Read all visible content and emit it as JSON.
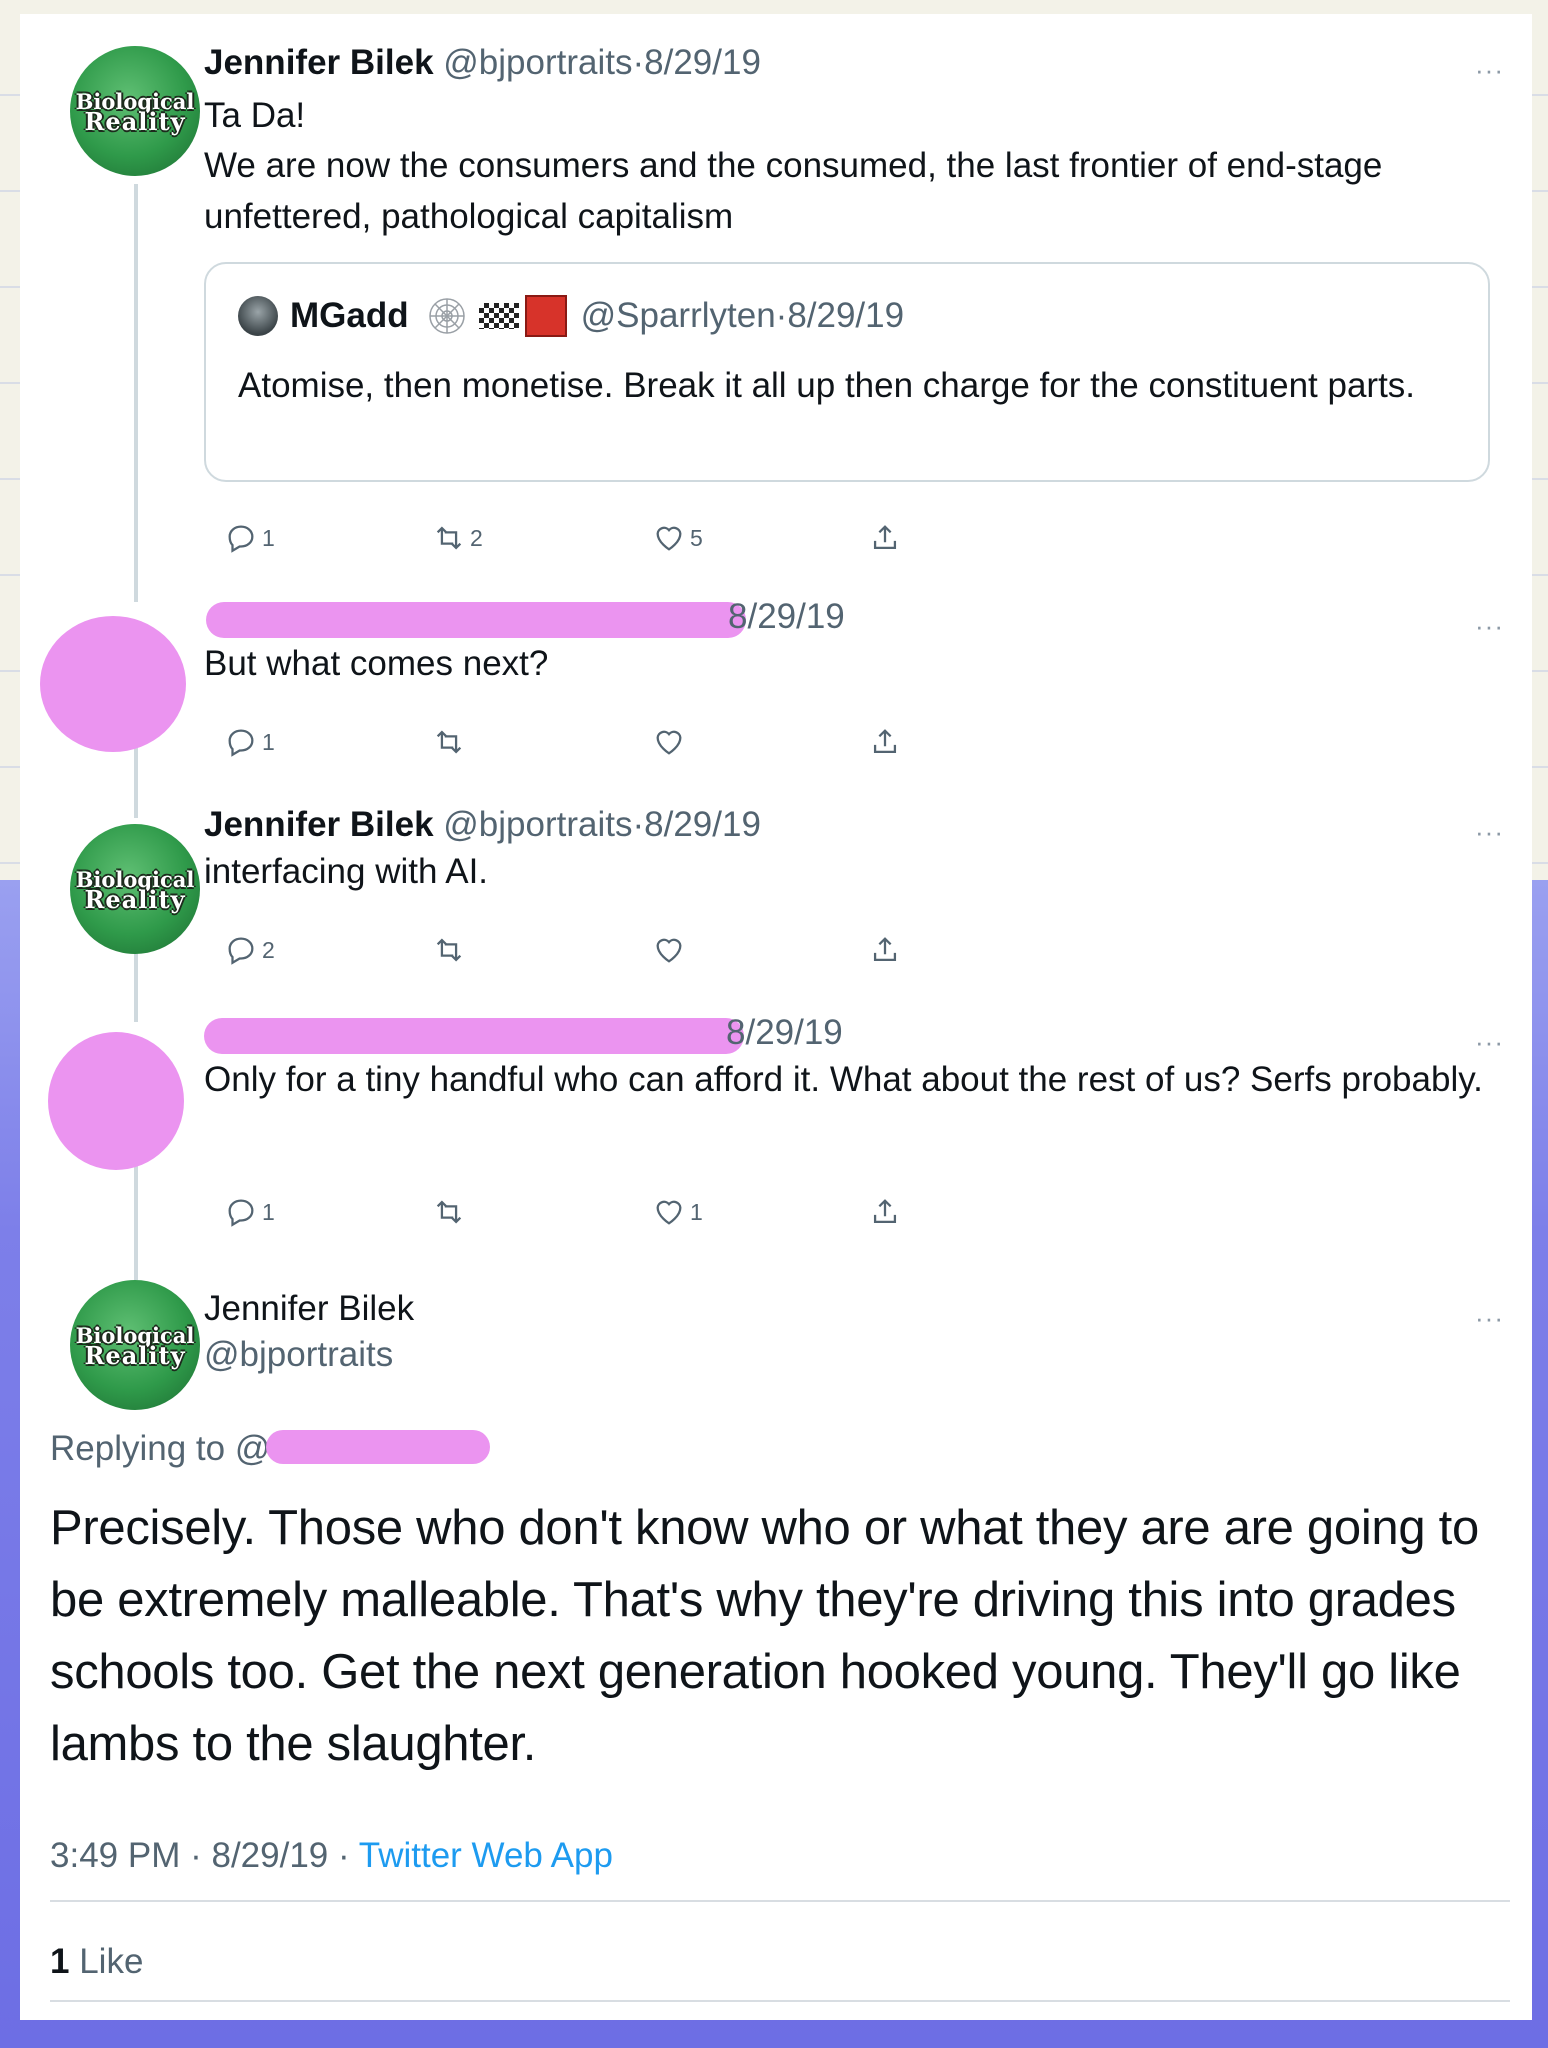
{
  "thread": {
    "tweet1": {
      "name": "Jennifer Bilek",
      "handle": "@bjportraits",
      "sep": "·",
      "date": "8/29/19",
      "line1": "Ta Da!",
      "line2": "We are now the consumers and the consumed, the last frontier of end-stage unfettered, pathological capitalism",
      "quote": {
        "name": "MGadd",
        "handle": "@Sparrlyten",
        "sep": "·",
        "date": "8/29/19",
        "text": "Atomise, then monetise. Break it all up then charge for the constituent parts."
      },
      "counts": {
        "reply": "1",
        "retweet": "2",
        "like": "5"
      }
    },
    "tweet2": {
      "date": "8/29/19",
      "text": "But what comes next?",
      "counts": {
        "reply": "1",
        "retweet": "",
        "like": ""
      }
    },
    "tweet3": {
      "name": "Jennifer Bilek",
      "handle": "@bjportraits",
      "sep": "·",
      "date": "8/29/19",
      "text": "interfacing with AI.",
      "counts": {
        "reply": "2",
        "retweet": "",
        "like": ""
      }
    },
    "tweet4": {
      "date": "8/29/19",
      "text": "Only for a tiny handful who can afford it. What about the rest of us? Serfs probably.",
      "counts": {
        "reply": "1",
        "retweet": "",
        "like": "1"
      }
    },
    "main": {
      "name": "Jennifer Bilek",
      "handle": "@bjportraits",
      "replying_to": "Replying to @",
      "text": "Precisely.  Those who don't know who or what they are are going to be extremely malleable.  That's why they're driving this into grades schools too.  Get the next generation hooked young. They'll go like lambs to the slaughter.",
      "time": "3:49 PM",
      "sep": "·",
      "date": "8/29/19",
      "sep2": "·",
      "app": "Twitter Web App",
      "likes_count": "1",
      "likes_label": "Like"
    },
    "avatar_logo": {
      "line1": "Biological",
      "line2": "Reality"
    },
    "more_label": "···"
  },
  "icons": [
    "reply-icon",
    "retweet-icon",
    "like-icon",
    "share-icon",
    "more-icon"
  ],
  "colors": {
    "accent": "#1d9bf0",
    "redaction": "#eb94f0",
    "muted": "#536471"
  }
}
